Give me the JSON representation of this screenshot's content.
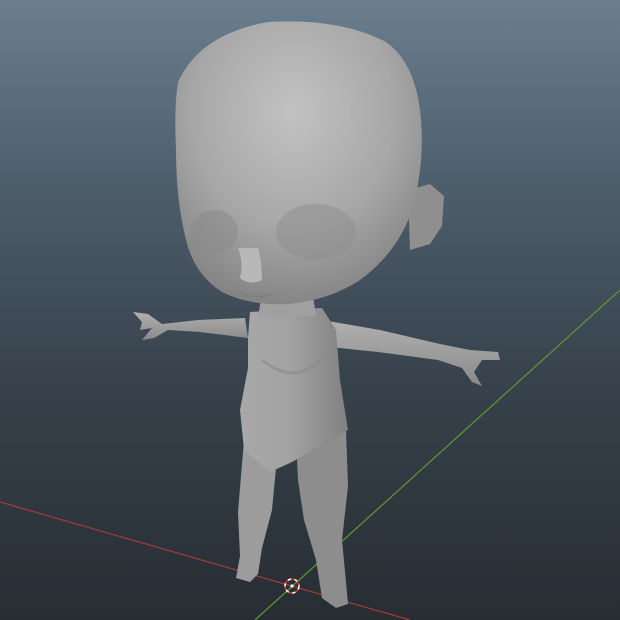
{
  "viewport": {
    "background_top": "#6a7e8d",
    "background_bottom": "#272d33",
    "axis_x_color": "#a33a3e",
    "axis_y_color": "#5c9b2e",
    "model_color": "#9a9a9a",
    "cursor_colors": [
      "#ffffff",
      "#d9342b"
    ]
  }
}
